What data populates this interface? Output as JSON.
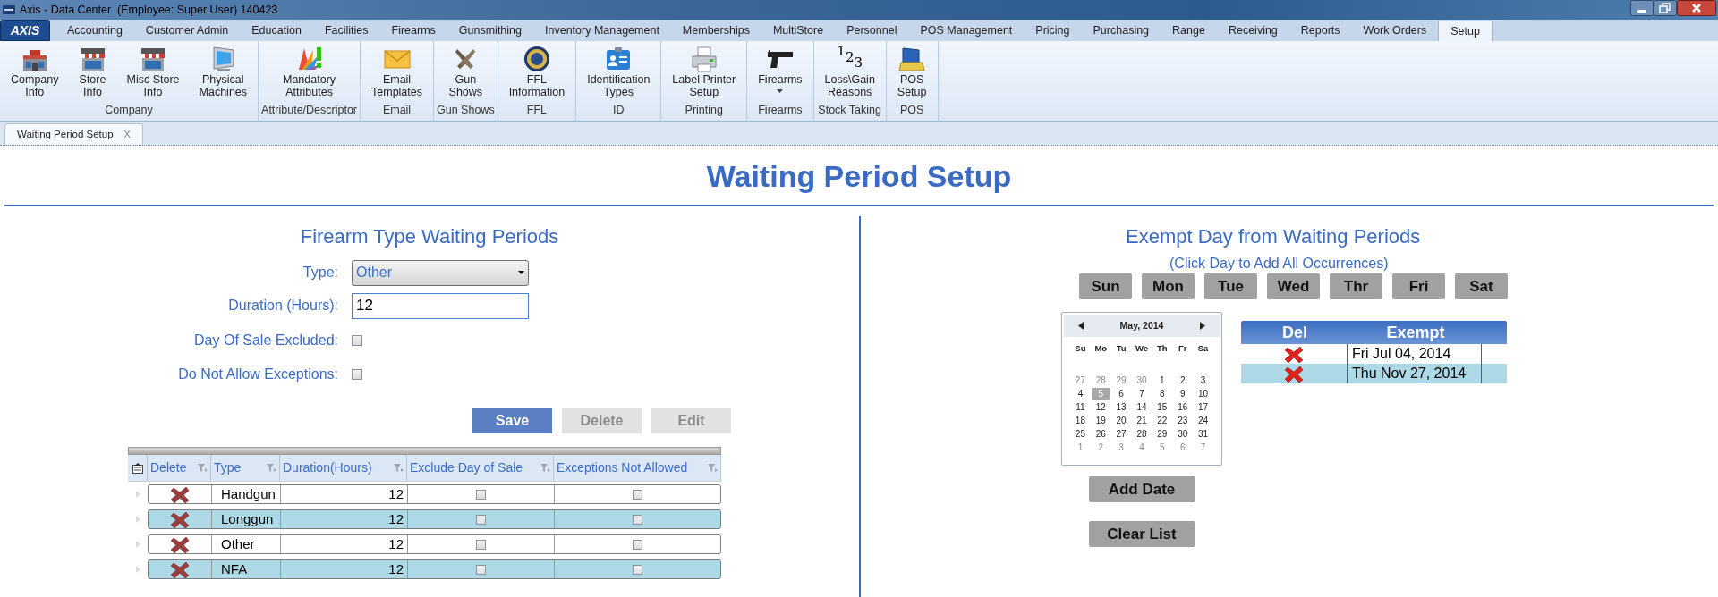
{
  "window": {
    "title": "Axis - Data Center  (Employee: Super User) 140423"
  },
  "menu": {
    "logo": "AXIS",
    "tabs": [
      {
        "label": "Accounting",
        "selected": false
      },
      {
        "label": "Customer Admin",
        "selected": false
      },
      {
        "label": "Education",
        "selected": false
      },
      {
        "label": "Facilities",
        "selected": false
      },
      {
        "label": "Firearms",
        "selected": false
      },
      {
        "label": "Gunsmithing",
        "selected": false
      },
      {
        "label": "Inventory Management",
        "selected": false
      },
      {
        "label": "Memberships",
        "selected": false
      },
      {
        "label": "MultiStore",
        "selected": false
      },
      {
        "label": "Personnel",
        "selected": false
      },
      {
        "label": "POS Management",
        "selected": false
      },
      {
        "label": "Pricing",
        "selected": false
      },
      {
        "label": "Purchasing",
        "selected": false
      },
      {
        "label": "Range",
        "selected": false
      },
      {
        "label": "Receiving",
        "selected": false
      },
      {
        "label": "Reports",
        "selected": false
      },
      {
        "label": "Work Orders",
        "selected": false
      },
      {
        "label": "Setup",
        "selected": true
      }
    ]
  },
  "ribbon": {
    "groups": [
      {
        "label": "Company",
        "items": [
          {
            "kind": "building",
            "label": "Company\nInfo"
          },
          {
            "kind": "store",
            "label": "Store\nInfo"
          },
          {
            "kind": "store",
            "label": "Misc Store\nInfo"
          },
          {
            "kind": "monitor",
            "label": "Physical\nMachines"
          }
        ]
      },
      {
        "label": "Attribute/Descriptor",
        "items": [
          {
            "kind": "palette",
            "label": "Mandatory\nAttributes"
          }
        ]
      },
      {
        "label": "Email",
        "items": [
          {
            "kind": "envelope",
            "label": "Email\nTemplates"
          }
        ]
      },
      {
        "label": "Gun Shows",
        "items": [
          {
            "kind": "pistols",
            "label": "Gun\nShows"
          }
        ]
      },
      {
        "label": "FFL",
        "items": [
          {
            "kind": "seal",
            "label": "FFL\nInformation"
          }
        ]
      },
      {
        "label": "ID",
        "items": [
          {
            "kind": "idcard",
            "label": "Identification\nTypes"
          }
        ]
      },
      {
        "label": "Printing",
        "items": [
          {
            "kind": "printer",
            "label": "Label Printer\nSetup"
          }
        ]
      },
      {
        "label": "Firearms",
        "items": [
          {
            "kind": "pistol",
            "label": "Firearms",
            "dropdown": true
          }
        ]
      },
      {
        "label": "Stock Taking",
        "items": [
          {
            "kind": "digits",
            "glyph": "123",
            "label": "Loss\\Gain\nReasons"
          }
        ]
      },
      {
        "label": "POS",
        "items": [
          {
            "kind": "pos",
            "label": "POS\nSetup"
          }
        ]
      }
    ]
  },
  "doc_tabs": [
    {
      "label": "Waiting Period Setup",
      "close": "X",
      "selected": true
    }
  ],
  "page": {
    "title": "Waiting Period Setup"
  },
  "firearm_periods": {
    "title": "Firearm Type Waiting Periods",
    "fields": [
      {
        "kind": "select",
        "label": "Type:",
        "value": "Other"
      },
      {
        "kind": "text",
        "label": "Duration (Hours):",
        "value": "12"
      },
      {
        "kind": "checkbox",
        "label": "Day Of Sale Excluded:",
        "checked": false
      },
      {
        "kind": "checkbox",
        "label": "Do Not Allow Exceptions:",
        "checked": false
      }
    ],
    "buttons": [
      {
        "label": "Save",
        "disabled": false
      },
      {
        "label": "Delete",
        "disabled": true
      },
      {
        "label": "Edit",
        "disabled": true
      }
    ],
    "grid": {
      "columns": [
        "Delete",
        "Type",
        "Duration(Hours)",
        "Exclude Day of Sale",
        "Exceptions Not Allowed"
      ],
      "rows": [
        {
          "type": "Handgun",
          "duration": "12",
          "exclude_day_of_sale": false,
          "exceptions_not_allowed": false
        },
        {
          "type": "Longgun",
          "duration": "12",
          "exclude_day_of_sale": false,
          "exceptions_not_allowed": false
        },
        {
          "type": "Other",
          "duration": "12",
          "exclude_day_of_sale": false,
          "exceptions_not_allowed": false
        },
        {
          "type": "NFA",
          "duration": "12",
          "exclude_day_of_sale": false,
          "exceptions_not_allowed": false
        }
      ]
    }
  },
  "exempt": {
    "title": "Exempt Day from Waiting Periods",
    "subtitle": "(Click Day to Add All Occurrences)",
    "days": [
      "Sun",
      "Mon",
      "Tue",
      "Wed",
      "Thr",
      "Fri",
      "Sat"
    ],
    "calendar": {
      "month": "May, 2014",
      "weekdays": [
        "Su",
        "Mo",
        "Tu",
        "We",
        "Th",
        "Fr",
        "Sa"
      ],
      "days": [
        {
          "label": "27",
          "muted": true,
          "selected": false
        },
        {
          "label": "28",
          "muted": true,
          "selected": false
        },
        {
          "label": "29",
          "muted": true,
          "selected": false
        },
        {
          "label": "30",
          "muted": true,
          "selected": false
        },
        {
          "label": "1",
          "muted": false,
          "selected": false
        },
        {
          "label": "2",
          "muted": false,
          "selected": false
        },
        {
          "label": "3",
          "muted": false,
          "selected": false
        },
        {
          "label": "4",
          "muted": false,
          "selected": false
        },
        {
          "label": "5",
          "muted": false,
          "selected": true
        },
        {
          "label": "6",
          "muted": false,
          "selected": false
        },
        {
          "label": "7",
          "muted": false,
          "selected": false
        },
        {
          "label": "8",
          "muted": false,
          "selected": false
        },
        {
          "label": "9",
          "muted": false,
          "selected": false
        },
        {
          "label": "10",
          "muted": false,
          "selected": false
        },
        {
          "label": "11",
          "muted": false,
          "selected": false
        },
        {
          "label": "12",
          "muted": false,
          "selected": false
        },
        {
          "label": "13",
          "muted": false,
          "selected": false
        },
        {
          "label": "14",
          "muted": false,
          "selected": false
        },
        {
          "label": "15",
          "muted": false,
          "selected": false
        },
        {
          "label": "16",
          "muted": false,
          "selected": false
        },
        {
          "label": "17",
          "muted": false,
          "selected": false
        },
        {
          "label": "18",
          "muted": false,
          "selected": false
        },
        {
          "label": "19",
          "muted": false,
          "selected": false
        },
        {
          "label": "20",
          "muted": false,
          "selected": false
        },
        {
          "label": "21",
          "muted": false,
          "selected": false
        },
        {
          "label": "22",
          "muted": false,
          "selected": false
        },
        {
          "label": "23",
          "muted": false,
          "selected": false
        },
        {
          "label": "24",
          "muted": false,
          "selected": false
        },
        {
          "label": "25",
          "muted": false,
          "selected": false
        },
        {
          "label": "26",
          "muted": false,
          "selected": false
        },
        {
          "label": "27",
          "muted": false,
          "selected": false
        },
        {
          "label": "28",
          "muted": false,
          "selected": false
        },
        {
          "label": "29",
          "muted": false,
          "selected": false
        },
        {
          "label": "30",
          "muted": false,
          "selected": false
        },
        {
          "label": "31",
          "muted": false,
          "selected": false
        },
        {
          "label": "1",
          "muted": true,
          "selected": false
        },
        {
          "label": "2",
          "muted": true,
          "selected": false
        },
        {
          "label": "3",
          "muted": true,
          "selected": false
        },
        {
          "label": "4",
          "muted": true,
          "selected": false
        },
        {
          "label": "5",
          "muted": true,
          "selected": false
        },
        {
          "label": "6",
          "muted": true,
          "selected": false
        },
        {
          "label": "7",
          "muted": true,
          "selected": false
        }
      ]
    },
    "table": {
      "columns": [
        "Del",
        "Exempt"
      ],
      "rows": [
        {
          "date": "Fri Jul 04, 2014"
        },
        {
          "date": "Thu Nov 27, 2014"
        }
      ]
    },
    "buttons": [
      "Add Date",
      "Clear List"
    ]
  }
}
